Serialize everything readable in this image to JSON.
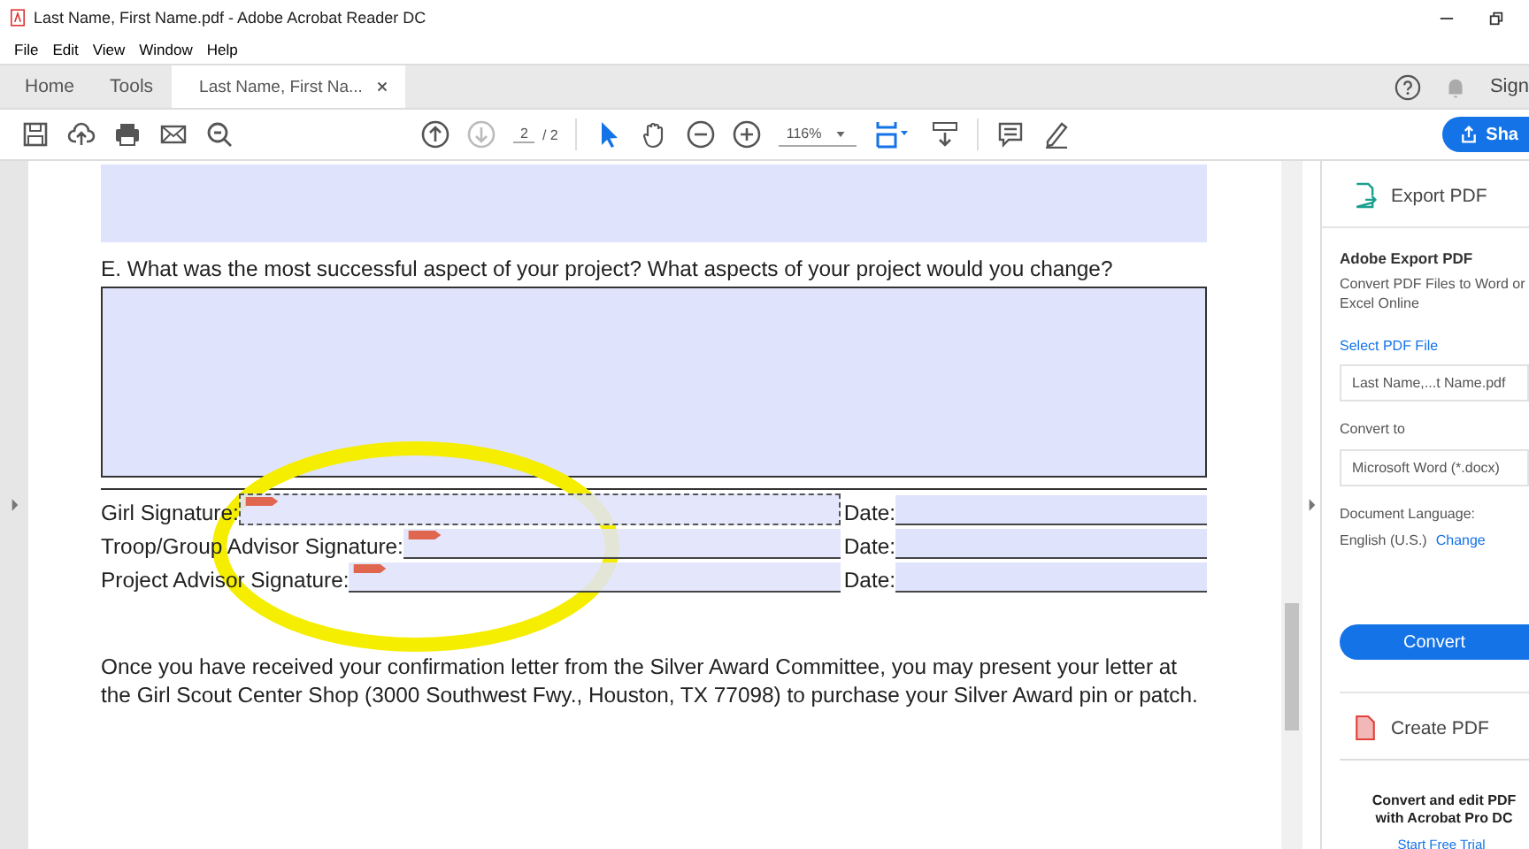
{
  "window": {
    "title": "Last Name, First Name.pdf - Adobe Acrobat Reader DC"
  },
  "menu": [
    "File",
    "Edit",
    "View",
    "Window",
    "Help"
  ],
  "tabs": [
    {
      "label": "Home",
      "selected": false
    },
    {
      "label": "Tools",
      "selected": false
    },
    {
      "label": "Last Name, First Na...",
      "selected": true,
      "closable": true
    }
  ],
  "top_right": {
    "sign_in": "Sign"
  },
  "toolbar": {
    "page": "2",
    "page_total": "/ 2",
    "zoom": "116%",
    "share": "Sha"
  },
  "document": {
    "question": "E. What was the most successful aspect of your project? What aspects of your project would you change?",
    "signature_rows": [
      {
        "label": "Girl Signature:",
        "date_label": "Date:",
        "focused": true
      },
      {
        "label": "Troop/Group Advisor Signature:",
        "date_label": "Date:",
        "focused": false
      },
      {
        "label": "Project Advisor Signature:",
        "date_label": "Date:",
        "focused": false
      }
    ],
    "paragraph": "Once you have received your confirmation letter from the Silver Award Committee, you may present your letter at the Girl Scout Center Shop (3000 Southwest Fwy., Houston, TX 77098) to purchase your Silver Award pin or patch."
  },
  "right_panel": {
    "export_title": "Export PDF",
    "heading": "Adobe Export PDF",
    "description": "Convert PDF Files to Word or Excel Online",
    "select_link": "Select PDF File",
    "file_name": "Last Name,...t Name.pdf",
    "convert_to_label": "Convert to",
    "convert_to_value": "Microsoft Word (*.docx)",
    "language_label": "Document Language:",
    "language_value": "English (U.S.)",
    "change_link": "Change",
    "convert_button": "Convert",
    "create_title": "Create PDF",
    "promo": [
      "Convert and edit PDF",
      "with Acrobat Pro DC"
    ],
    "trial_link": "Start Free Trial"
  }
}
